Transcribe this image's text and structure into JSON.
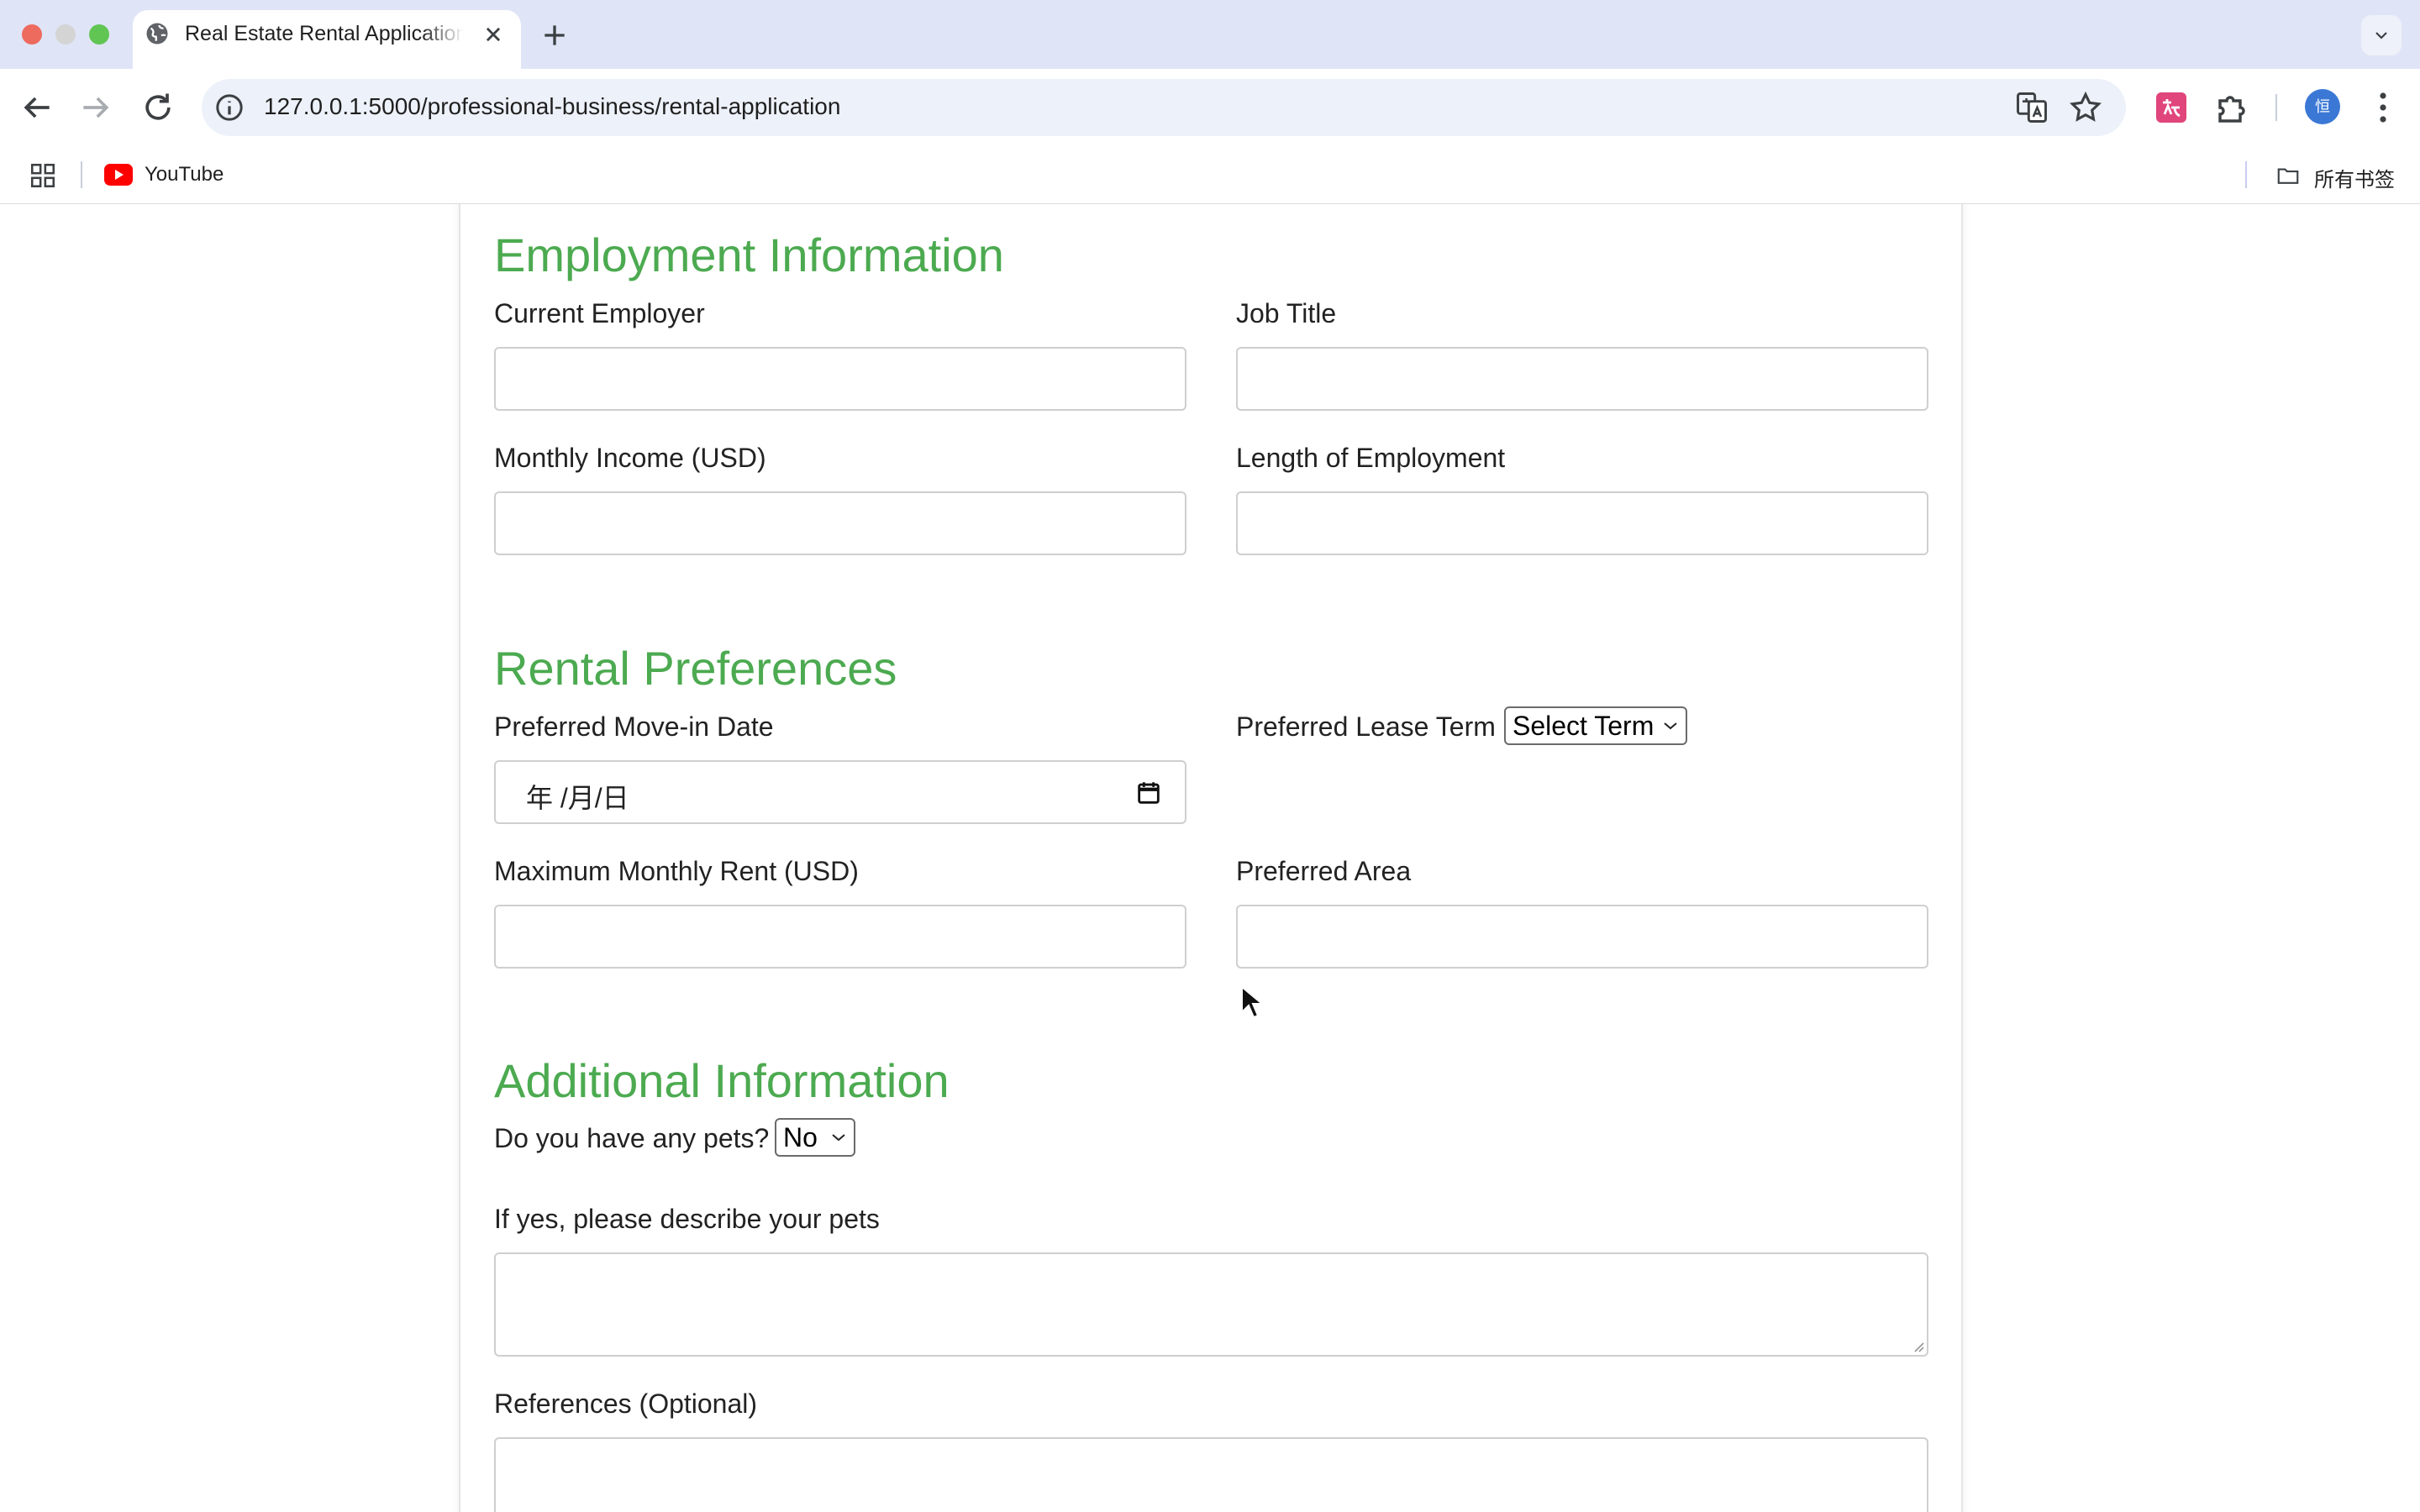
{
  "browser": {
    "tab_title": "Real Estate Rental Application",
    "url": "127.0.0.1:5000/professional-business/rental-application",
    "bookmarks": [
      {
        "label": "YouTube",
        "icon": "youtube-icon"
      }
    ],
    "all_bookmarks_label": "所有书签",
    "profile_initial": "恒"
  },
  "form": {
    "employment": {
      "title": "Employment Information",
      "current_employer_label": "Current Employer",
      "job_title_label": "Job Title",
      "monthly_income_label": "Monthly Income (USD)",
      "length_of_employment_label": "Length of Employment"
    },
    "rental": {
      "title": "Rental Preferences",
      "move_in_label": "Preferred Move-in Date",
      "move_in_placeholder": "年 /月/日",
      "lease_term_label": "Preferred Lease Term",
      "lease_term_value": "Select Term",
      "max_rent_label": "Maximum Monthly Rent (USD)",
      "preferred_area_label": "Preferred Area"
    },
    "additional": {
      "title": "Additional Information",
      "pets_label": "Do you have any pets?",
      "pets_value": "No",
      "pets_desc_label": "If yes, please describe your pets",
      "references_label": "References (Optional)"
    }
  },
  "colors": {
    "section_title": "#4caa50",
    "tabstrip_bg": "#dfe5f6"
  }
}
